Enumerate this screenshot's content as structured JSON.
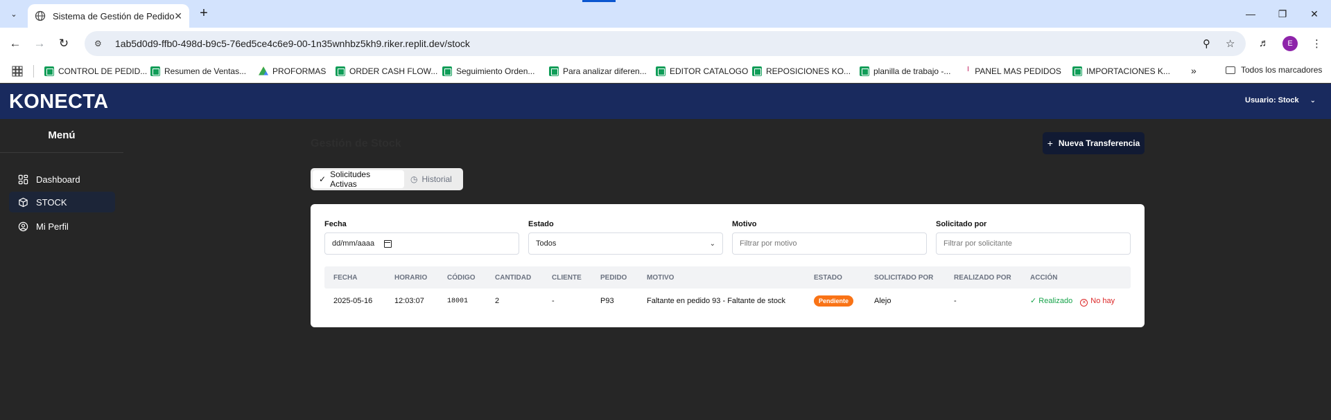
{
  "browser": {
    "tab_title": "Sistema de Gestión de Pedidos",
    "url": "1ab5d0d9-ffb0-498d-b9c5-76ed5ce4c6e9-00-1n35wnhbz5kh9.riker.replit.dev/stock",
    "profile_initial": "E",
    "bookmarks": [
      {
        "label": "CONTROL DE PEDID...",
        "icon": "sheets-icon"
      },
      {
        "label": "Resumen de Ventas...",
        "icon": "sheets-icon"
      },
      {
        "label": "PROFORMAS",
        "icon": "drive-icon"
      },
      {
        "label": "ORDER CASH FLOW...",
        "icon": "sheets-icon"
      },
      {
        "label": "Seguimiento Orden...",
        "icon": "sheets-icon"
      },
      {
        "label": "Para analizar diferen...",
        "icon": "sheets-icon"
      },
      {
        "label": "EDITOR CATALOGO",
        "icon": "sheets-icon"
      },
      {
        "label": "REPOSICIONES KO...",
        "icon": "sheets-icon"
      },
      {
        "label": "planilla de trabajo -...",
        "icon": "sheets-icon"
      },
      {
        "label": "PANEL MAS PEDIDOS",
        "icon": "panel-icon"
      },
      {
        "label": "IMPORTACIONES K...",
        "icon": "sheets-icon"
      }
    ],
    "all_bookmarks": "Todos los marcadores"
  },
  "header": {
    "logo": "KONECTA",
    "user_label": "Usuario: Stock",
    "brand_color": "#192a5e"
  },
  "sidebar": {
    "title": "Menú",
    "items": [
      {
        "label": "Dashboard",
        "icon": "dashboard-icon",
        "active": false
      },
      {
        "label": "STOCK",
        "icon": "box-icon",
        "active": true
      },
      {
        "label": "Mi Perfil",
        "icon": "user-circle-icon",
        "active": false
      }
    ]
  },
  "main": {
    "title": "Gestión de Stock",
    "new_button": "Nueva Transferencia",
    "tabs": [
      {
        "label": "Solicitudes Activas",
        "active": true
      },
      {
        "label": "Historial",
        "active": false
      }
    ],
    "filters": {
      "fecha_label": "Fecha",
      "fecha_value": "dd/mm/aaaa",
      "estado_label": "Estado",
      "estado_value": "Todos",
      "motivo_label": "Motivo",
      "motivo_placeholder": "Filtrar por motivo",
      "solicitado_label": "Solicitado por",
      "solicitado_placeholder": "Filtrar por solicitante"
    },
    "table": {
      "columns": [
        "FECHA",
        "HORARIO",
        "CÓDIGO",
        "CANTIDAD",
        "CLIENTE",
        "PEDIDO",
        "MOTIVO",
        "ESTADO",
        "SOLICITADO POR",
        "REALIZADO POR",
        "ACCIÓN"
      ],
      "rows": [
        {
          "fecha": "2025-05-16",
          "horario": "12:03:07",
          "codigo": "18001",
          "cantidad": "2",
          "cliente": "-",
          "pedido": "P93",
          "motivo": "Faltante en pedido 93 - Faltante de stock",
          "estado": "Pendiente",
          "solicitado_por": "Alejo",
          "realizado_por": "-",
          "accion_ok": "Realizado",
          "accion_no": "No hay"
        }
      ]
    }
  }
}
